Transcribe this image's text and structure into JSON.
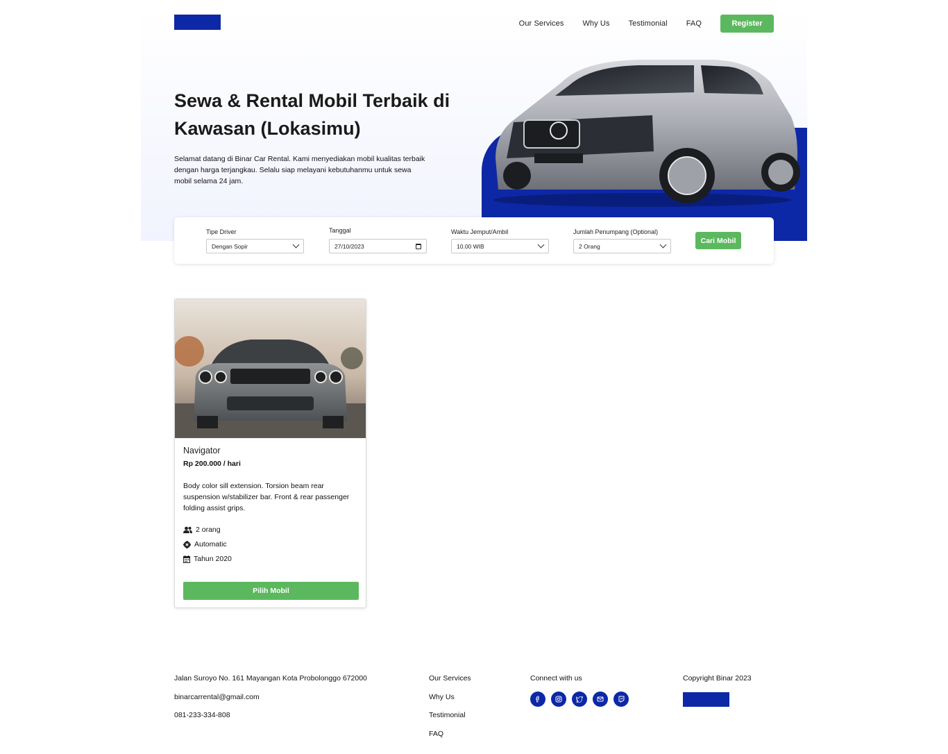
{
  "nav": {
    "items": [
      "Our Services",
      "Why Us",
      "Testimonial",
      "FAQ"
    ],
    "register_label": "Register"
  },
  "hero": {
    "title": "Sewa & Rental Mobil Terbaik di Kawasan (Lokasimu)",
    "description": "Selamat datang di Binar Car Rental. Kami menyediakan mobil kualitas terbaik dengan harga terjangkau. Selalu siap melayani kebutuhanmu untuk sewa mobil selama 24 jam."
  },
  "search": {
    "driver_label": "Tipe Driver",
    "driver_value": "Dengan Sopir",
    "date_label": "Tanggal",
    "date_value": "27/10/2023",
    "time_label": "Waktu Jemput/Ambil",
    "time_value": "10.00 WIB",
    "passenger_label": "Jumlah Penumpang (Optional)",
    "passenger_value": "2 Orang",
    "submit_label": "Cari Mobil"
  },
  "cars": [
    {
      "name": "Navigator",
      "price": "Rp 200.000 / hari",
      "description": "Body color sill extension. Torsion beam rear suspension w/stabilizer bar. Front & rear passenger folding assist grips.",
      "capacity": "2 orang",
      "transmission": "Automatic",
      "year": "Tahun 2020",
      "button_label": "Pilih Mobil"
    }
  ],
  "footer": {
    "address": "Jalan Suroyo No. 161 Mayangan Kota Probolonggo 672000",
    "email": "binarcarrental@gmail.com",
    "phone": "081-233-334-808",
    "links": [
      "Our Services",
      "Why Us",
      "Testimonial",
      "FAQ"
    ],
    "connect_label": "Connect with us",
    "social_icons": [
      "facebook-icon",
      "instagram-icon",
      "twitter-icon",
      "mail-icon",
      "twitch-icon"
    ],
    "copyright": "Copyright Binar 2023"
  },
  "colors": {
    "brand_blue": "#0d28a6",
    "accent_green": "#5cb85f",
    "hero_bg": "#f1f3fe"
  }
}
